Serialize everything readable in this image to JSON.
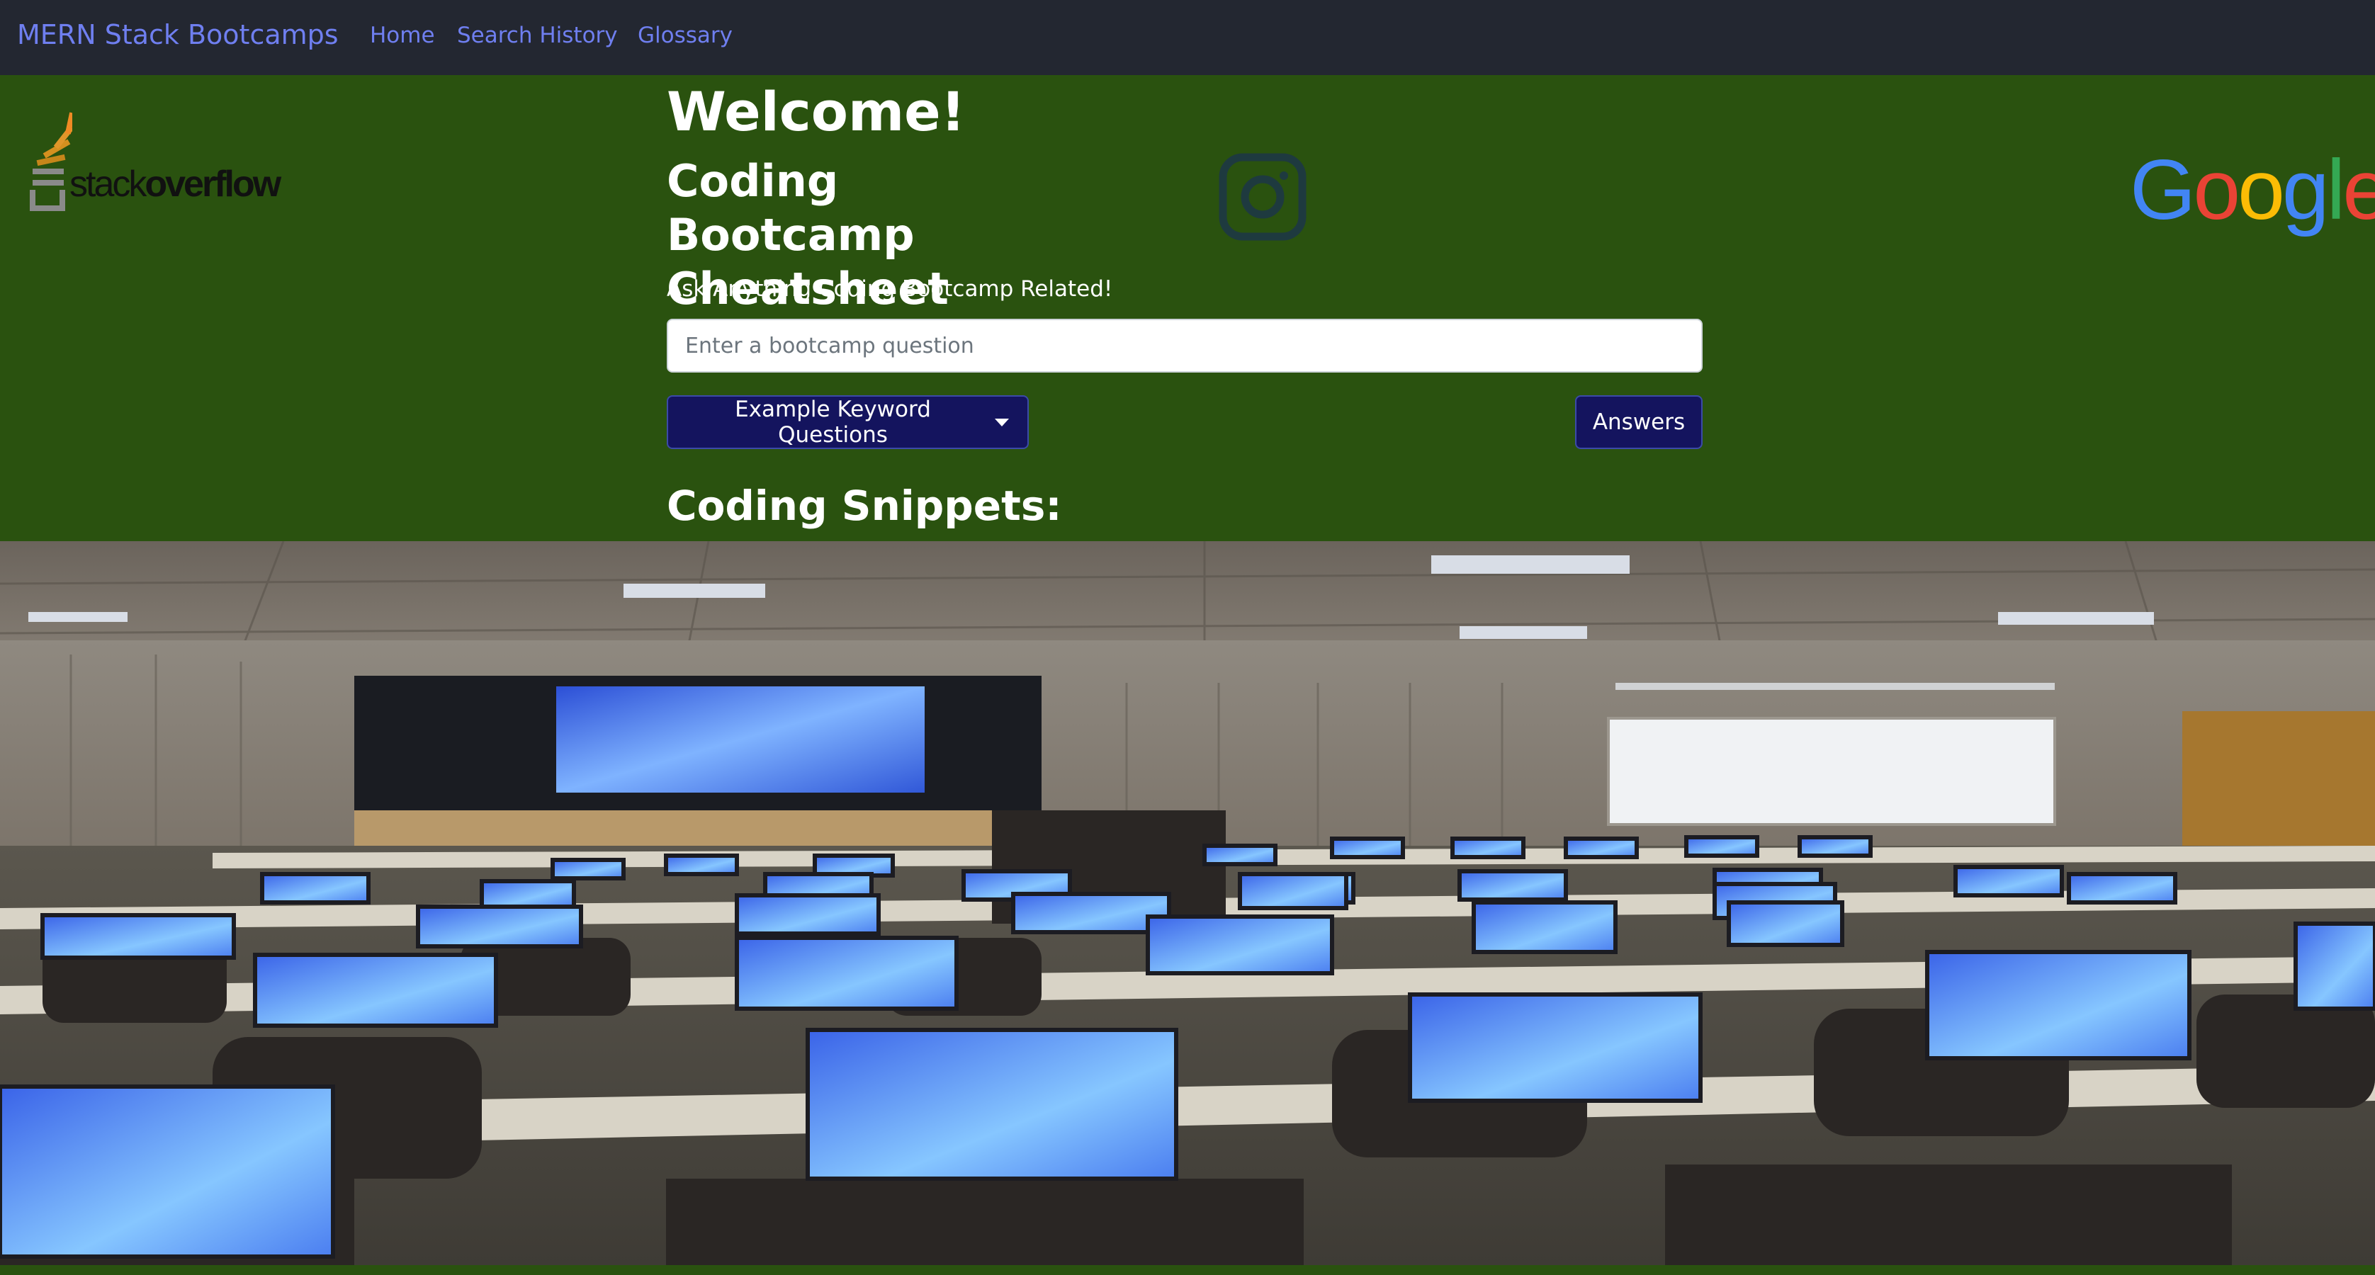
{
  "navbar": {
    "brand": "MERN Stack Bootcamps",
    "links": [
      "Home",
      "Search History",
      "Glossary"
    ]
  },
  "hero": {
    "welcome": "Welcome!",
    "subtitle": "Coding Bootcamp Cheatsheet",
    "tagline": "Ask Anything Coding Bootcamp Related!",
    "search_placeholder": "Enter a bootcamp question",
    "examples_button": "Example Keyword Questions",
    "answers_button": "Answers",
    "snippets_heading": "Coding Snippets:"
  },
  "logos": {
    "stackoverflow": {
      "prefix": "stack",
      "suffix": "overflow"
    },
    "google": [
      "G",
      "o",
      "o",
      "g",
      "l",
      "e"
    ],
    "google_colors": [
      "#4285F4",
      "#EA4335",
      "#FBBC05",
      "#4285F4",
      "#34A853",
      "#EA4335"
    ],
    "instagram_icon": "instagram-icon"
  },
  "colors": {
    "navbar_bg": "#232731",
    "hero_bg": "#2a520f",
    "link": "#6f7ff0",
    "button_bg": "#14145e"
  }
}
